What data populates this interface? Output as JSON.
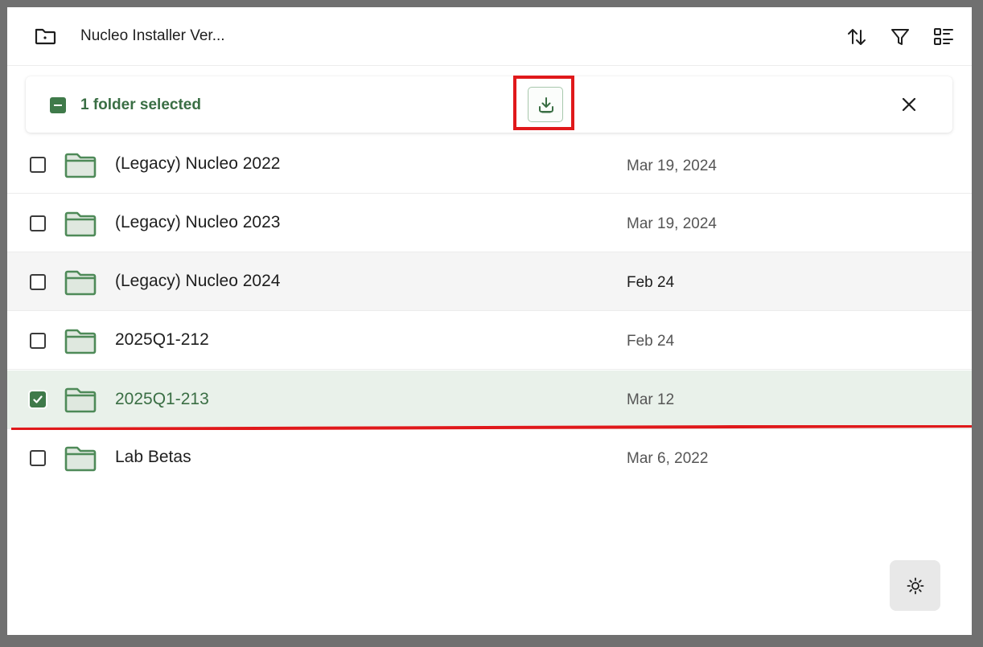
{
  "header": {
    "title": "Nucleo Installer Ver...",
    "icons": [
      "folder-icon",
      "sort-icon",
      "filter-icon",
      "view-options-icon"
    ]
  },
  "selection_bar": {
    "text": "1 folder selected",
    "actions": [
      "download-icon",
      "close-icon"
    ]
  },
  "rows": [
    {
      "name": "(Legacy) Nucleo 2022",
      "date": "Mar 19, 2024",
      "checked": false,
      "state": "default"
    },
    {
      "name": "(Legacy) Nucleo 2023",
      "date": "Mar 19, 2024",
      "checked": false,
      "state": "default"
    },
    {
      "name": "(Legacy) Nucleo 2024",
      "date": "Feb 24",
      "checked": false,
      "state": "hovered"
    },
    {
      "name": "2025Q1-212",
      "date": "Feb 24",
      "checked": false,
      "state": "default"
    },
    {
      "name": "2025Q1-213",
      "date": "Mar 12",
      "checked": true,
      "state": "selected"
    },
    {
      "name": "Lab Betas",
      "date": "Mar 6, 2022",
      "checked": false,
      "state": "default"
    }
  ],
  "theme_toggle": {
    "icon": "sun-icon"
  },
  "colors": {
    "accent": "#3f7a4a",
    "accent_text": "#3a6e44",
    "folder_fill": "#dfe8df",
    "selected_row": "#e9f1ea",
    "annotation_red": "#e0191b"
  }
}
